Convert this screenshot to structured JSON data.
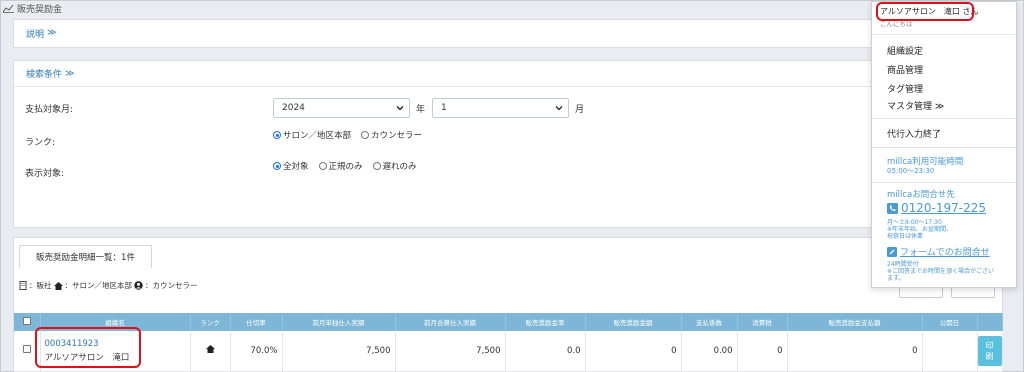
{
  "page": {
    "title": "販売奨励金"
  },
  "explain": {
    "label": "説明",
    "toggle": "≫"
  },
  "search": {
    "label": "検索条件",
    "toggle": "≫",
    "payment_month_label": "支払対象月:",
    "year_value": "2024",
    "year_unit": "年",
    "month_value": "1",
    "month_unit": "月",
    "rank_label": "ランク:",
    "rank_options": [
      "サロン／地区本部",
      "カウンセラー"
    ],
    "rank_selected": "サロン／地区本部",
    "display_label": "表示対象:",
    "display_options": [
      "全対象",
      "正規のみ",
      "遅れのみ"
    ],
    "display_selected": "全対象"
  },
  "list": {
    "tab_label": "販売奨励金明細一覧：1件",
    "legend_company": "：販社",
    "legend_salon": "：サロン／地区本部",
    "legend_counselor": "：カウンセラー",
    "columns": [
      "",
      "組織名",
      "ランク",
      "仕切率",
      "前月単独仕入実績",
      "前月合算仕入実績",
      "販売奨励金率",
      "販売奨励金額",
      "支払係数",
      "消費税",
      "販売奨励金支払額",
      "公開日",
      ""
    ],
    "rows": [
      {
        "org_code": "0003411923",
        "org_name": "アルソアサロン　滝口",
        "rank_icon": "home-icon",
        "rate": "70.0%",
        "single": "7,500",
        "combined": "7,500",
        "incentive_rate": "0.0",
        "incentive_amount": "0",
        "coef": "0.00",
        "tax": "0",
        "payment": "0",
        "published": "",
        "print_label": "印刷"
      }
    ]
  },
  "user_menu": {
    "user": "アルソアサロン　滝口 さん",
    "greeting": "こんにちは",
    "items": [
      "組織設定",
      "商品管理",
      "タグ管理",
      "マスタ管理 ≫"
    ],
    "end_proxy": "代行入力終了",
    "hours_title": "millca利用可能時間",
    "hours_value": "05:00〜23:30",
    "contact_title": "millcaお問合せ先",
    "phone": "0120-197-225",
    "phone_note1": "月〜土9:00〜17:30",
    "phone_note2": "※年末年始、お盆期間、",
    "phone_note3": "祝祭日は休業",
    "form_label": "フォームでのお問合せ",
    "form_note1": "24時間受付",
    "form_note2": "※ご回答までお時間を頂く場合がござい",
    "form_note3": "ます。"
  },
  "colors": {
    "accent": "#2a7ab8",
    "header": "#7eb6d7",
    "highlight": "#e0101a",
    "print": "#5bc0de"
  }
}
